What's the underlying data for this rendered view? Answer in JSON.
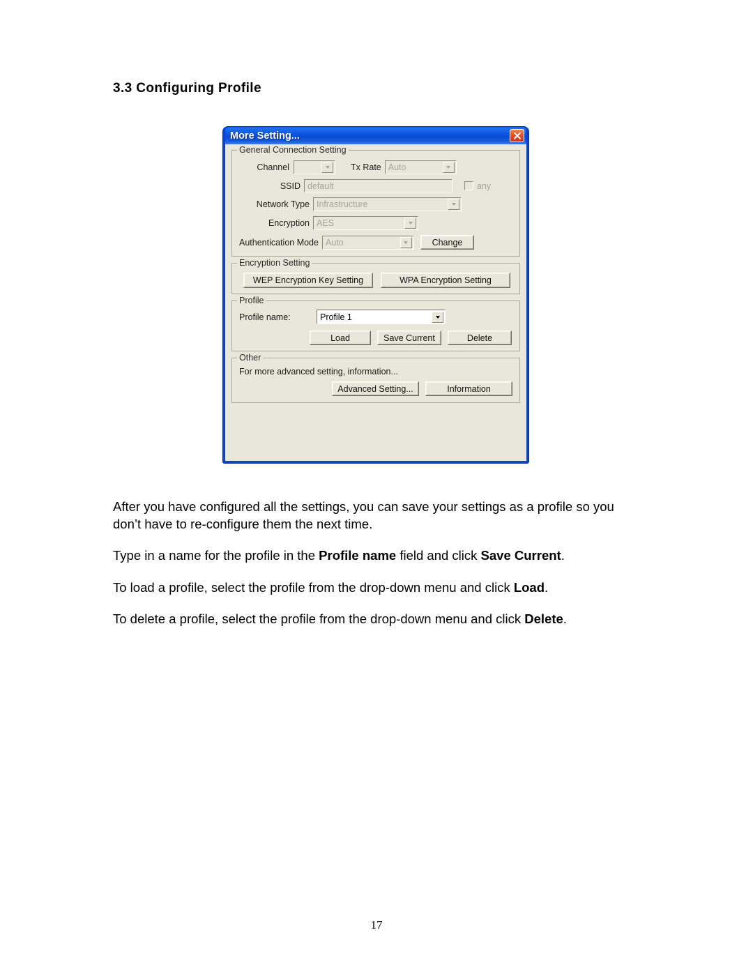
{
  "document": {
    "heading": "3.3 Configuring Profile",
    "page_number": "17",
    "paragraphs": {
      "p1_part1": "After you have configured all the settings, you can save your settings as a profile so you don’t have to re-configure them the next time.",
      "p2_part1": "Type in a name for the profile in the ",
      "p2_bold1": "Profile name",
      "p2_part2": " field and click ",
      "p2_bold2": "Save Current",
      "p2_part3": ".",
      "p3_part1": "To load a profile, select the profile from the drop-down menu and click ",
      "p3_bold1": "Load",
      "p3_part2": ".",
      "p4_part1": "To delete a profile, select the profile from the drop-down menu and click ",
      "p4_bold1": "Delete",
      "p4_part2": "."
    }
  },
  "dialog": {
    "title": "More Setting...",
    "close_icon": "close-icon",
    "colors": {
      "titlebar_blue": "#0b55e0",
      "border_blue": "#0a43d2",
      "client_bg": "#e9e7da",
      "close_red": "#e2542a",
      "disabled_text": "#a7a496"
    },
    "general_connection": {
      "legend": "General Connection Setting",
      "channel_label": "Channel",
      "channel_value": "",
      "tx_rate_label": "Tx Rate",
      "tx_rate_value": "Auto",
      "ssid_label": "SSID",
      "ssid_value": "default",
      "any_label": "any",
      "any_checked": false,
      "network_type_label": "Network Type",
      "network_type_value": "Infrastructure",
      "encryption_label": "Encryption",
      "encryption_value": "AES",
      "auth_mode_label": "Authentication Mode",
      "auth_mode_value": "Auto",
      "change_button": "Change"
    },
    "encryption_setting": {
      "legend": "Encryption Setting",
      "wep_button": "WEP Encryption Key Setting",
      "wpa_button": "WPA Encryption Setting"
    },
    "profile": {
      "legend": "Profile",
      "name_label": "Profile name:",
      "name_value": "Profile 1",
      "load_button": "Load",
      "save_current_button": "Save Current",
      "delete_button": "Delete"
    },
    "other": {
      "legend": "Other",
      "description": "For more advanced setting, information...",
      "advanced_button": "Advanced Setting...",
      "information_button": "Information"
    }
  }
}
